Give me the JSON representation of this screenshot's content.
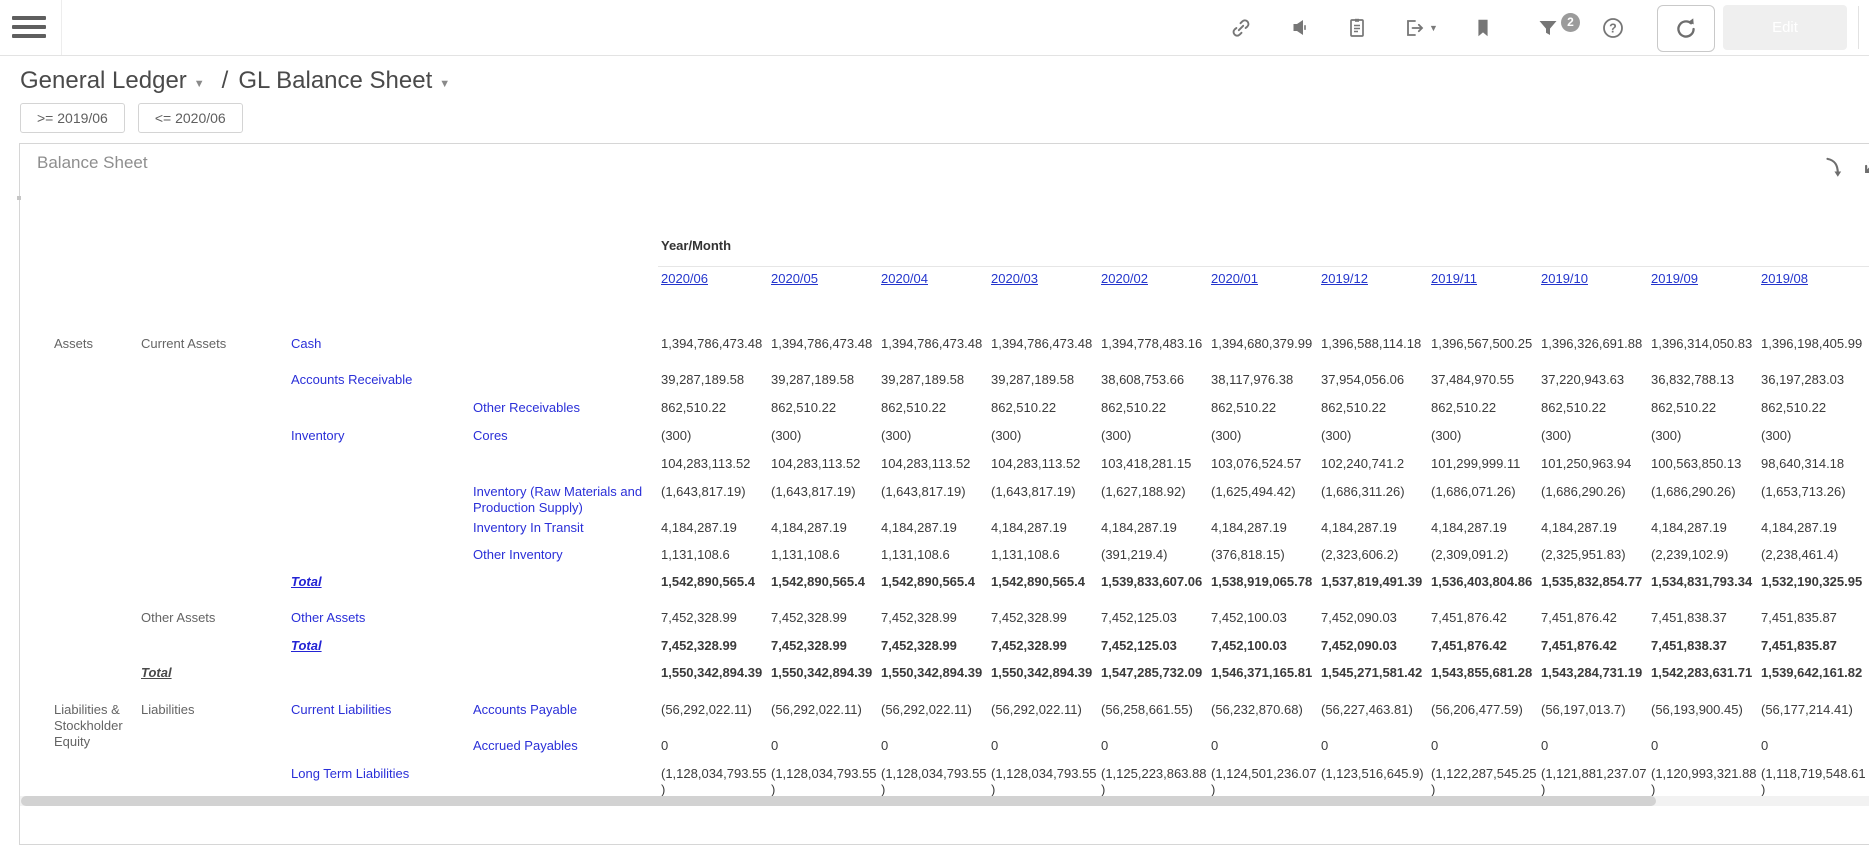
{
  "toolbar": {
    "edit_label": "Edit",
    "filter_badge": "2",
    "icons": [
      "link-icon",
      "announce-icon",
      "copy-icon",
      "export-icon",
      "bookmark-icon",
      "filter-icon",
      "help-icon",
      "refresh-icon"
    ]
  },
  "breadcrumb": {
    "section": "General Ledger",
    "page": "GL Balance Sheet"
  },
  "filters": {
    "from": ">= 2019/06",
    "to": "<= 2020/06"
  },
  "panel": {
    "title": "Balance Sheet",
    "icons": [
      "drill-down-icon",
      "expand-icon"
    ]
  },
  "colors": {
    "accent_blue": "#2a7de2",
    "link_blue": "#2a2fd8",
    "month_link_blue": "#2435cd",
    "text_gray": "#646464",
    "value_gray": "#3b3b3b"
  },
  "table": {
    "col_header_label": "Year/Month",
    "columns": [
      "2020/06",
      "2020/05",
      "2020/04",
      "2020/03",
      "2020/02",
      "2020/01",
      "2019/12",
      "2019/11",
      "2019/10",
      "2019/09",
      "2019/08"
    ],
    "rows": [
      {
        "cells": [
          {
            "col": 0,
            "text": "Assets",
            "style": "plain"
          },
          {
            "col": 1,
            "text": "Current Assets",
            "style": "plain"
          },
          {
            "col": 2,
            "text": "Cash",
            "style": "link"
          }
        ],
        "bold": false,
        "values": [
          "1,394,786,473.48",
          "1,394,786,473.48",
          "1,394,786,473.48",
          "1,394,786,473.48",
          "1,394,778,483.16",
          "1,394,680,379.99",
          "1,396,588,114.18",
          "1,396,567,500.25",
          "1,396,326,691.88",
          "1,396,314,050.83",
          "1,396,198,405.99"
        ]
      },
      {
        "cells": [
          {
            "col": 2,
            "text": "Accounts Receivable",
            "style": "link"
          }
        ],
        "bold": false,
        "values": [
          "39,287,189.58",
          "39,287,189.58",
          "39,287,189.58",
          "39,287,189.58",
          "38,608,753.66",
          "38,117,976.38",
          "37,954,056.06",
          "37,484,970.55",
          "37,220,943.63",
          "36,832,788.13",
          "36,197,283.03"
        ]
      },
      {
        "cells": [
          {
            "col": 3,
            "text": "Other Receivables",
            "style": "link"
          }
        ],
        "bold": false,
        "values": [
          "862,510.22",
          "862,510.22",
          "862,510.22",
          "862,510.22",
          "862,510.22",
          "862,510.22",
          "862,510.22",
          "862,510.22",
          "862,510.22",
          "862,510.22",
          "862,510.22"
        ]
      },
      {
        "cells": [
          {
            "col": 2,
            "text": "Inventory",
            "style": "link"
          },
          {
            "col": 3,
            "text": "Cores",
            "style": "link"
          }
        ],
        "bold": false,
        "values": [
          "(300)",
          "(300)",
          "(300)",
          "(300)",
          "(300)",
          "(300)",
          "(300)",
          "(300)",
          "(300)",
          "(300)",
          "(300)"
        ]
      },
      {
        "cells": [],
        "bold": false,
        "values": [
          "104,283,113.52",
          "104,283,113.52",
          "104,283,113.52",
          "104,283,113.52",
          "103,418,281.15",
          "103,076,524.57",
          "102,240,741.2",
          "101,299,999.11",
          "101,250,963.94",
          "100,563,850.13",
          "98,640,314.18"
        ]
      },
      {
        "cells": [
          {
            "col": 3,
            "text": "Inventory (Raw Materials and Production Supply)",
            "style": "link"
          }
        ],
        "bold": false,
        "values": [
          "(1,643,817.19)",
          "(1,643,817.19)",
          "(1,643,817.19)",
          "(1,643,817.19)",
          "(1,627,188.92)",
          "(1,625,494.42)",
          "(1,686,311.26)",
          "(1,686,071.26)",
          "(1,686,290.26)",
          "(1,686,290.26)",
          "(1,653,713.26)"
        ]
      },
      {
        "cells": [
          {
            "col": 3,
            "text": "Inventory In Transit",
            "style": "link"
          }
        ],
        "bold": false,
        "values": [
          "4,184,287.19",
          "4,184,287.19",
          "4,184,287.19",
          "4,184,287.19",
          "4,184,287.19",
          "4,184,287.19",
          "4,184,287.19",
          "4,184,287.19",
          "4,184,287.19",
          "4,184,287.19",
          "4,184,287.19"
        ]
      },
      {
        "cells": [
          {
            "col": 3,
            "text": "Other Inventory",
            "style": "link"
          }
        ],
        "bold": false,
        "values": [
          "1,131,108.6",
          "1,131,108.6",
          "1,131,108.6",
          "1,131,108.6",
          "(391,219.4)",
          "(376,818.15)",
          "(2,323,606.2)",
          "(2,309,091.2)",
          "(2,325,951.83)",
          "(2,239,102.9)",
          "(2,238,461.4)"
        ]
      },
      {
        "cells": [
          {
            "col": 2,
            "text": "Total",
            "style": "total_link"
          }
        ],
        "bold": true,
        "values": [
          "1,542,890,565.4",
          "1,542,890,565.4",
          "1,542,890,565.4",
          "1,542,890,565.4",
          "1,539,833,607.06",
          "1,538,919,065.78",
          "1,537,819,491.39",
          "1,536,403,804.86",
          "1,535,832,854.77",
          "1,534,831,793.34",
          "1,532,190,325.95"
        ]
      },
      {
        "cells": [
          {
            "col": 1,
            "text": "Other Assets",
            "style": "plain"
          },
          {
            "col": 2,
            "text": "Other Assets",
            "style": "link"
          }
        ],
        "bold": false,
        "values": [
          "7,452,328.99",
          "7,452,328.99",
          "7,452,328.99",
          "7,452,328.99",
          "7,452,125.03",
          "7,452,100.03",
          "7,452,090.03",
          "7,451,876.42",
          "7,451,876.42",
          "7,451,838.37",
          "7,451,835.87"
        ]
      },
      {
        "cells": [
          {
            "col": 2,
            "text": "Total",
            "style": "total_link"
          }
        ],
        "bold": true,
        "values": [
          "7,452,328.99",
          "7,452,328.99",
          "7,452,328.99",
          "7,452,328.99",
          "7,452,125.03",
          "7,452,100.03",
          "7,452,090.03",
          "7,451,876.42",
          "7,451,876.42",
          "7,451,838.37",
          "7,451,835.87"
        ]
      },
      {
        "cells": [
          {
            "col": 1,
            "text": "Total",
            "style": "total_dark"
          }
        ],
        "bold": true,
        "values": [
          "1,550,342,894.39",
          "1,550,342,894.39",
          "1,550,342,894.39",
          "1,550,342,894.39",
          "1,547,285,732.09",
          "1,546,371,165.81",
          "1,545,271,581.42",
          "1,543,855,681.28",
          "1,543,284,731.19",
          "1,542,283,631.71",
          "1,539,642,161.82"
        ]
      },
      {
        "cells": [
          {
            "col": 0,
            "text": "Liabilities & Stockholder Equity",
            "style": "plain"
          },
          {
            "col": 1,
            "text": "Liabilities",
            "style": "plain"
          },
          {
            "col": 2,
            "text": "Current Liabilities",
            "style": "link"
          },
          {
            "col": 3,
            "text": "Accounts Payable",
            "style": "link"
          }
        ],
        "bold": false,
        "values": [
          "(56,292,022.11)",
          "(56,292,022.11)",
          "(56,292,022.11)",
          "(56,292,022.11)",
          "(56,258,661.55)",
          "(56,232,870.68)",
          "(56,227,463.81)",
          "(56,206,477.59)",
          "(56,197,013.7)",
          "(56,193,900.45)",
          "(56,177,214.41)"
        ]
      },
      {
        "cells": [
          {
            "col": 3,
            "text": "Accrued Payables",
            "style": "link"
          }
        ],
        "bold": false,
        "values": [
          "0",
          "0",
          "0",
          "0",
          "0",
          "0",
          "0",
          "0",
          "0",
          "0",
          "0"
        ]
      },
      {
        "cells": [
          {
            "col": 2,
            "text": "Long Term Liabilities",
            "style": "link"
          }
        ],
        "bold": false,
        "values": [
          "(1,128,034,793.55)",
          "(1,128,034,793.55)",
          "(1,128,034,793.55)",
          "(1,128,034,793.55)",
          "(1,125,223,863.88)",
          "(1,124,501,236.07)",
          "(1,123,516,645.9)",
          "(1,122,287,545.25)",
          "(1,121,881,237.07)",
          "(1,120,993,321.88)",
          "(1,118,719,548.61)"
        ]
      }
    ]
  }
}
